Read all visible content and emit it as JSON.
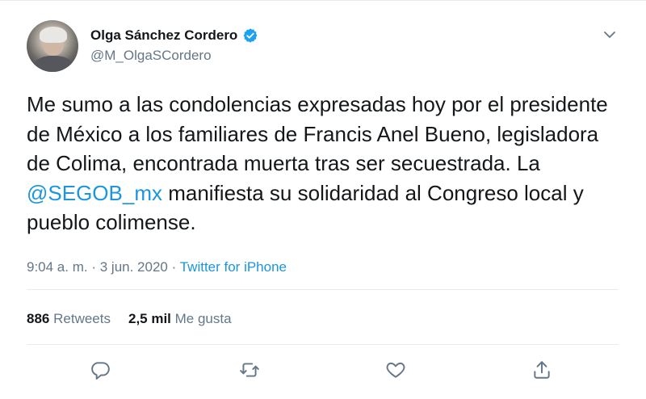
{
  "author": {
    "display_name": "Olga Sánchez Cordero",
    "handle": "@M_OlgaSCordero",
    "verified": true
  },
  "tweet": {
    "text_before_mention": "Me sumo a las condolencias expresadas hoy por el presidente de México a los familiares de Francis Anel Bueno, legisladora de Colima, encontrada muerta tras ser secuestrada. La ",
    "mention": "@SEGOB_mx",
    "text_after_mention": " manifiesta su solidaridad al Congreso local y pueblo colimense."
  },
  "meta": {
    "time": "9:04 a. m.",
    "separator": "·",
    "date": "3 jun. 2020",
    "source": "Twitter for iPhone"
  },
  "stats": {
    "retweets_count": "886",
    "retweets_label": "Retweets",
    "likes_count": "2,5 mil",
    "likes_label": "Me gusta"
  },
  "actions": {
    "reply_icon": "reply-icon",
    "retweet_icon": "retweet-icon",
    "like_icon": "heart-icon",
    "share_icon": "share-icon"
  },
  "colors": {
    "link": "#1b95e0",
    "secondary_text": "#657786",
    "primary_text": "#14171a",
    "divider": "#e6ecf0"
  }
}
